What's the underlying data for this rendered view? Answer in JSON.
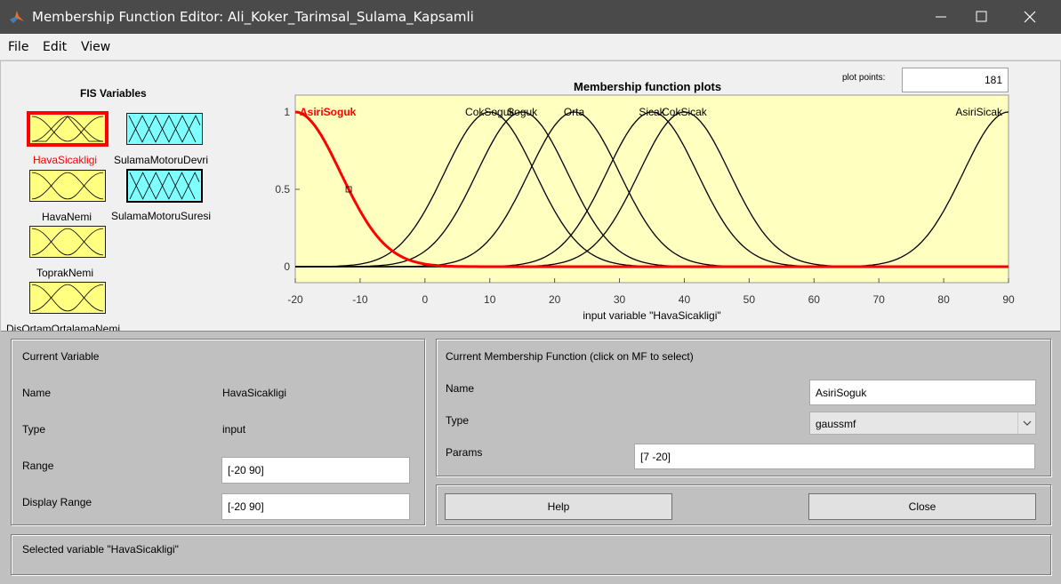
{
  "window": {
    "title": "Membership Function Editor: Ali_Koker_Tarimsal_Sulama_Kapsamli"
  },
  "menu": {
    "file": "File",
    "edit": "Edit",
    "view": "View"
  },
  "fis_variables": {
    "title": "FIS Variables",
    "inputs": [
      {
        "label": "HavaSicakligi",
        "selected": true
      },
      {
        "label": "HavaNemi"
      },
      {
        "label": "ToprakNemi"
      },
      {
        "label": "DisOrtamOrtalamaNemi"
      }
    ],
    "outputs": [
      {
        "label": "SulamaMotoruDevri"
      },
      {
        "label": "SulamaMotoruSuresi"
      }
    ]
  },
  "plot_points": {
    "label": "plot points:",
    "value": "181"
  },
  "plot": {
    "title": "Membership function plots"
  },
  "chart_data": {
    "type": "line",
    "title": "Membership function plots",
    "xlabel": "input variable \"HavaSicakligi\"",
    "ylabel": "",
    "xlim": [
      -20,
      90
    ],
    "ylim": [
      0,
      1
    ],
    "x_ticks": [
      -20,
      -10,
      0,
      10,
      20,
      30,
      40,
      50,
      60,
      70,
      80,
      90
    ],
    "y_ticks": [
      0,
      0.5,
      1
    ],
    "series": [
      {
        "name": "AsiriSoguk",
        "mf": "gaussmf",
        "sigma": 7,
        "center": -20,
        "selected": true
      },
      {
        "name": "CokSoguk",
        "mf": "gaussmf",
        "sigma": 7,
        "center": 10
      },
      {
        "name": "Soguk",
        "mf": "gaussmf",
        "sigma": 7,
        "center": 15
      },
      {
        "name": "Orta",
        "mf": "gaussmf",
        "sigma": 7,
        "center": 23
      },
      {
        "name": "Sicak",
        "mf": "gaussmf",
        "sigma": 7,
        "center": 35
      },
      {
        "name": "CokSicak",
        "mf": "gaussmf",
        "sigma": 7,
        "center": 40
      },
      {
        "name": "AsiriSicak",
        "mf": "gaussmf",
        "sigma": 7,
        "center": 90
      }
    ],
    "colors": {
      "background": "#ffffc0",
      "selected": "#ff0000",
      "curve": "#000000"
    }
  },
  "current_variable": {
    "title": "Current Variable",
    "name_label": "Name",
    "name_value": "HavaSicakligi",
    "type_label": "Type",
    "type_value": "input",
    "range_label": "Range",
    "range_value": "[-20 90]",
    "display_range_label": "Display Range",
    "display_range_value": "[-20 90]"
  },
  "current_mf": {
    "title": "Current Membership Function (click on MF to select)",
    "name_label": "Name",
    "name_value": "AsiriSoguk",
    "type_label": "Type",
    "type_value": "gaussmf",
    "params_label": "Params",
    "params_value": "[7 -20]"
  },
  "buttons": {
    "help": "Help",
    "close": "Close"
  },
  "status": {
    "text": "Selected variable \"HavaSicakligi\""
  }
}
